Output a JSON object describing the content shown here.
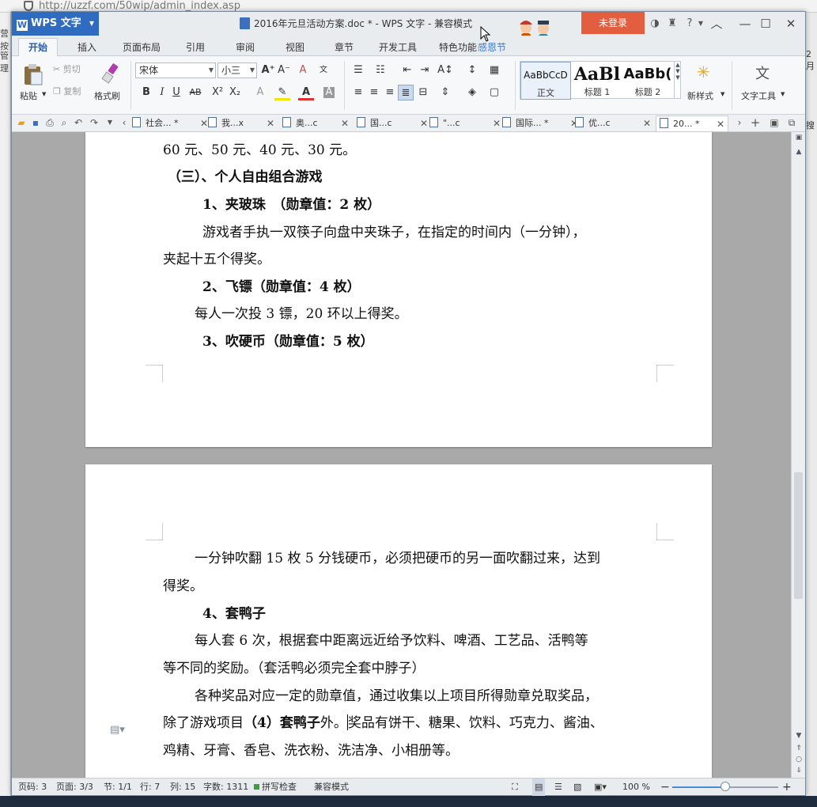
{
  "browser": {
    "url": "http://uzzf.com/50wip/admin_index.asp",
    "left_fragments": [
      "营按",
      "管理"
    ],
    "right_fragments": [
      "2月",
      "搜"
    ]
  },
  "app": {
    "menu_label": "WPS 文字",
    "title": "2016年元旦活动方案.doc * - WPS 文字 - 兼容模式",
    "login_label": "未登录",
    "help_label": "?"
  },
  "ribbon_tabs": [
    "开始",
    "插入",
    "页面布局",
    "引用",
    "审阅",
    "视图",
    "章节",
    "开发工具",
    "特色功能",
    "感恩节"
  ],
  "ribbon": {
    "paste": "粘贴",
    "cut": "剪切",
    "copy": "复制",
    "format_painter": "格式刷",
    "font_name": "宋体",
    "font_size": "小三",
    "styles": [
      {
        "sample": "AaBbCcD",
        "label": "正文"
      },
      {
        "sample": "AaBl",
        "label": "标题 1"
      },
      {
        "sample": "AaBb(",
        "label": "标题 2"
      }
    ],
    "new_style": "新样式",
    "text_tools": "文字工具"
  },
  "doc_tabs": [
    {
      "label": "社会...",
      "modified": true
    },
    {
      "label": "我...x",
      "modified": false
    },
    {
      "label": "奥...c",
      "modified": false
    },
    {
      "label": "国...c",
      "modified": false
    },
    {
      "label": "\"...c",
      "modified": false
    },
    {
      "label": "国际...",
      "modified": true
    },
    {
      "label": "优...c",
      "modified": false
    },
    {
      "label": "20...",
      "modified": true,
      "active": true
    }
  ],
  "document": {
    "page1": [
      "60 元、50 元、40 元、30 元。",
      "（三）、个人自由组合游戏",
      "1、夹玻珠　（勋章值：2 枚）",
      "游戏者手执一双筷子向盘中夹珠子，在指定的时间内（一分钟），",
      "夹起十五个得奖。",
      "2、飞镖（勋章值：4 枚）",
      "每人一次投 3 镖，20 环以上得奖。",
      "3、吹硬币（勋章值：5 枚）"
    ],
    "page2": [
      "一分钟吹翻 15 枚 5 分钱硬币，必须把硬币的另一面吹翻过来，达到",
      "得奖。",
      "4、套鸭子",
      "每人套 6 次，根据套中距离远近给予饮料、啤酒、工艺品、活鸭等",
      "等不同的奖励。（套活鸭必须完全套中脖子）",
      "各种奖品对应一定的勋章值，通过收集以上项目所得勋章兑取奖品，",
      "鸡精、牙膏、香皂、洗衣粉、洗洁净、小相册等。"
    ],
    "page2_line7": {
      "a": "除了游戏项目",
      "b": "（4）套鸭子",
      "c": "外。",
      "d": "奖品有饼干、糖果、饮料、巧克力、酱油、"
    }
  },
  "status": {
    "page_code": "页码: 3",
    "pages": "页面: 3/3",
    "section": "节: 1/1",
    "row": "行: 7",
    "col": "列: 15",
    "word_count": "字数: 1311",
    "spell_check": "拼写检查",
    "mode": "兼容模式",
    "zoom": "100 %",
    "zoom_level_percent": 50
  }
}
